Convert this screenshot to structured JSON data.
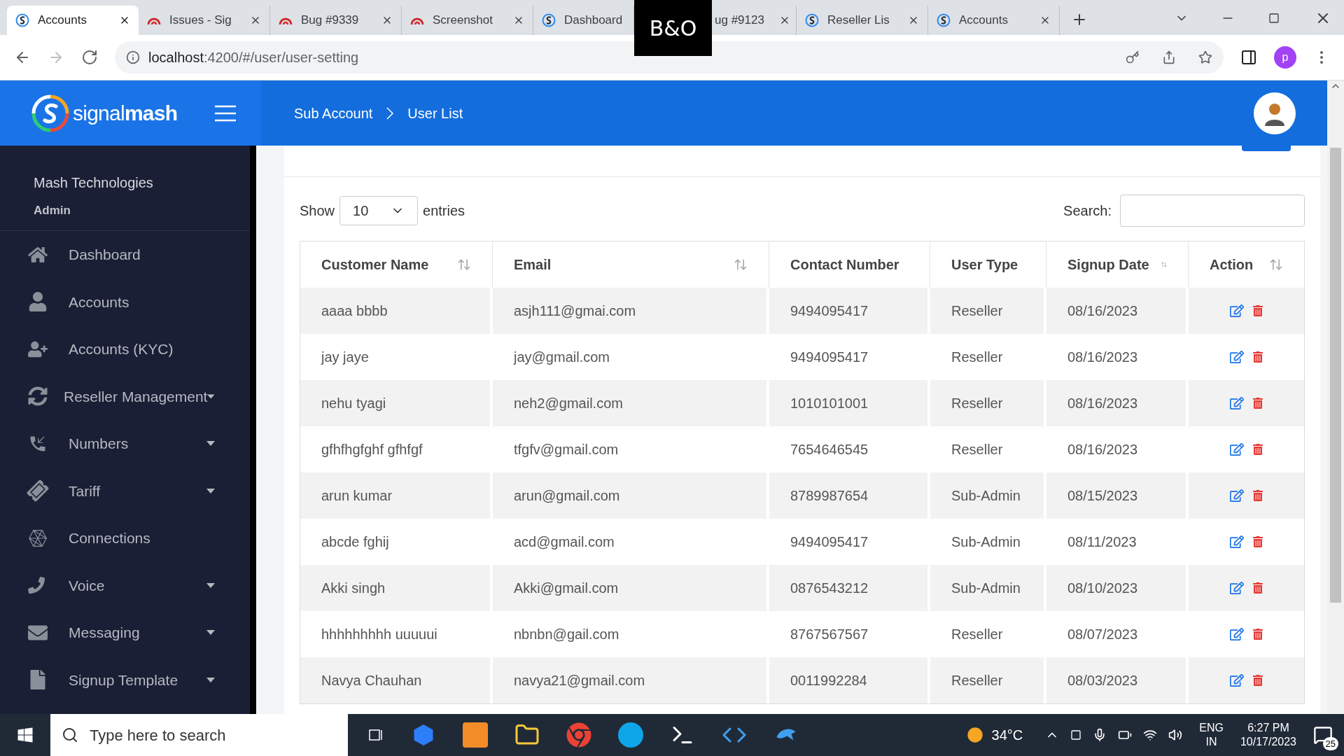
{
  "browser": {
    "tabs": [
      {
        "title": "Accounts",
        "selected": true
      },
      {
        "title": "Issues - Sig",
        "selected": false
      },
      {
        "title": "Bug #9339",
        "selected": false
      },
      {
        "title": "Screenshot",
        "selected": false
      },
      {
        "title": "Dashboard",
        "selected": false
      },
      {
        "title": "ug #9123",
        "selected": false
      },
      {
        "title": "Reseller Lis",
        "selected": false
      },
      {
        "title": "Accounts",
        "selected": false
      }
    ],
    "url_host": "localhost",
    "url_path": ":4200/#/user/user-setting",
    "profile": "p",
    "overlay_logo": "B&O"
  },
  "header": {
    "brand_light": "signal",
    "brand_bold": "mash",
    "breadcrumbs": [
      "Sub Account",
      "User List"
    ]
  },
  "sidebar": {
    "org": "Mash Technologies",
    "role": "Admin",
    "items": [
      {
        "label": "Dashboard",
        "has_submenu": false
      },
      {
        "label": "Accounts",
        "has_submenu": false
      },
      {
        "label": "Accounts (KYC)",
        "has_submenu": false
      },
      {
        "label": "Reseller Management",
        "has_submenu": true
      },
      {
        "label": "Numbers",
        "has_submenu": true
      },
      {
        "label": "Tariff",
        "has_submenu": true
      },
      {
        "label": "Connections",
        "has_submenu": false
      },
      {
        "label": "Voice",
        "has_submenu": true
      },
      {
        "label": "Messaging",
        "has_submenu": true
      },
      {
        "label": "Signup Template",
        "has_submenu": true
      }
    ]
  },
  "table_controls": {
    "show_label": "Show",
    "page_size": "10",
    "entries_label": "entries",
    "search_label": "Search:"
  },
  "table": {
    "columns": [
      "Customer Name",
      "Email",
      "Contact Number",
      "User Type",
      "Signup Date",
      "Action"
    ],
    "rows": [
      [
        "aaaa bbbb",
        "asjh111@gmai.com",
        "9494095417",
        "Reseller",
        "08/16/2023"
      ],
      [
        "jay jaye",
        "jay@gmail.com",
        "9494095417",
        "Reseller",
        "08/16/2023"
      ],
      [
        "nehu tyagi",
        "neh2@gmail.com",
        "1010101001",
        "Reseller",
        "08/16/2023"
      ],
      [
        "gfhfhgfghf gfhfgf",
        "tfgfv@gmail.com",
        "7654646545",
        "Reseller",
        "08/16/2023"
      ],
      [
        "arun kumar",
        "arun@gmail.com",
        "8789987654",
        "Sub-Admin",
        "08/15/2023"
      ],
      [
        "abcde fghij",
        "acd@gmail.com",
        "9494095417",
        "Sub-Admin",
        "08/11/2023"
      ],
      [
        "Akki singh",
        "Akki@gmail.com",
        "0876543212",
        "Sub-Admin",
        "08/10/2023"
      ],
      [
        "hhhhhhhhh uuuuui",
        "nbnbn@gail.com",
        "8767567567",
        "Reseller",
        "08/07/2023"
      ],
      [
        "Navya Chauhan",
        "navya21@gmail.com",
        "0011992284",
        "Reseller",
        "08/03/2023"
      ]
    ]
  },
  "taskbar": {
    "search_placeholder": "Type here to search",
    "temperature": "34°C",
    "lang": "ENG",
    "region": "IN",
    "time": "6:27 PM",
    "date": "10/17/2023",
    "notifications": "25"
  }
}
